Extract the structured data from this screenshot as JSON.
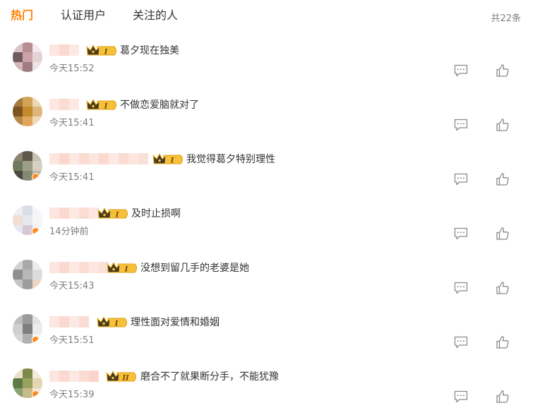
{
  "tabs": [
    {
      "label": "热门",
      "active": true
    },
    {
      "label": "认证用户",
      "active": false
    },
    {
      "label": "关注的人",
      "active": false
    }
  ],
  "total_count": "共22条",
  "icons": {
    "vip_badge": "crown-vip-icon",
    "reply": "comment-reply-icon",
    "like": "thumbs-up-icon"
  },
  "colors": {
    "accent": "#ff8200",
    "text": "#333333",
    "muted": "#808080",
    "icon": "#8a8a8a"
  },
  "comments": [
    {
      "text": "葛夕现在独美",
      "time": "今天15:52",
      "vip_level": "I"
    },
    {
      "text": "不做恋爱脑就对了",
      "time": "今天15:41",
      "vip_level": "I"
    },
    {
      "text": "我觉得葛夕特别理性",
      "time": "今天15:41",
      "vip_level": "I"
    },
    {
      "text": "及时止损啊",
      "time": "14分钟前",
      "vip_level": "I"
    },
    {
      "text": "没想到留几手的老婆是她",
      "time": "今天15:43",
      "vip_level": "I"
    },
    {
      "text": "理性面对爱情和婚姻",
      "time": "今天15:51",
      "vip_level": "I"
    },
    {
      "text": "磨合不了就果断分手，不能犹豫",
      "time": "今天15:39",
      "vip_level": "II"
    }
  ]
}
